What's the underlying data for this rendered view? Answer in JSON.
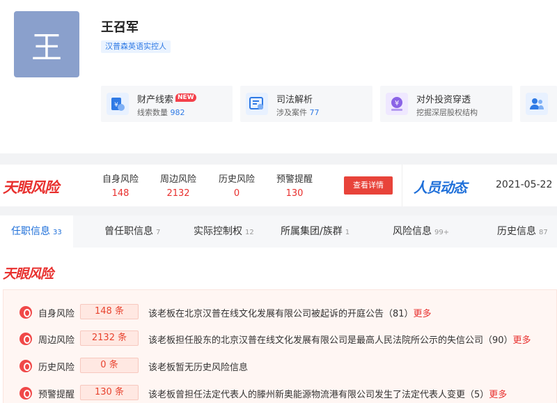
{
  "profile": {
    "avatar_char": "王",
    "name": "王召军",
    "role_tag": "汉普森英语实控人"
  },
  "cards": [
    {
      "title": "财产线索",
      "badge": "NEW",
      "sub_label": "线索数量",
      "sub_value": "982",
      "icon": "money-bag-icon"
    },
    {
      "title": "司法解析",
      "sub_label": "涉及案件",
      "sub_value": "77",
      "icon": "legal-doc-icon"
    },
    {
      "title": "对外投资穿透",
      "sub_label": "挖掘深层股权结构",
      "icon": "investment-icon"
    },
    {
      "icon": "people-icon"
    }
  ],
  "risk_bar": {
    "logo": "天眼风险",
    "stats": [
      {
        "label": "自身风险",
        "value": "148"
      },
      {
        "label": "周边风险",
        "value": "2132"
      },
      {
        "label": "历史风险",
        "value": "0"
      },
      {
        "label": "预警提醒",
        "value": "130"
      }
    ],
    "detail_button": "查看详情",
    "dynamics_logo": "人员动态",
    "date": "2021-05-22"
  },
  "tabs": [
    {
      "label": "任职信息",
      "count": "33"
    },
    {
      "label": "曾任职信息",
      "count": "7"
    },
    {
      "label": "实际控制权",
      "count": "12"
    },
    {
      "label": "所属集团/族群",
      "count": "1"
    },
    {
      "label": "风险信息",
      "count": "99+"
    },
    {
      "label": "历史信息",
      "count": "87"
    }
  ],
  "section": {
    "logo": "天眼风险",
    "rows": [
      {
        "label": "自身风险",
        "pill": "148 条",
        "desc": "该老板在北京汉普在线文化发展有限公司被起诉的开庭公告（81）",
        "more": "更多"
      },
      {
        "label": "周边风险",
        "pill": "2132 条",
        "desc": "该老板担任股东的北京汉普在线文化发展有限公司是最高人民法院所公示的失信公司（90）",
        "more": "更多"
      },
      {
        "label": "历史风险",
        "pill": "0 条",
        "desc": "该老板暂无历史风险信息",
        "more": ""
      },
      {
        "label": "预警提醒",
        "pill": "130 条",
        "desc": "该老板曾担任法定代表人的滕州新奥能源物流港有限公司发生了法定代表人变更（5）",
        "more": "更多"
      }
    ]
  },
  "colors": {
    "risk_red": "#e8302e",
    "brand_blue": "#1e6fd9",
    "avatar_bg": "#8aa0cc"
  }
}
